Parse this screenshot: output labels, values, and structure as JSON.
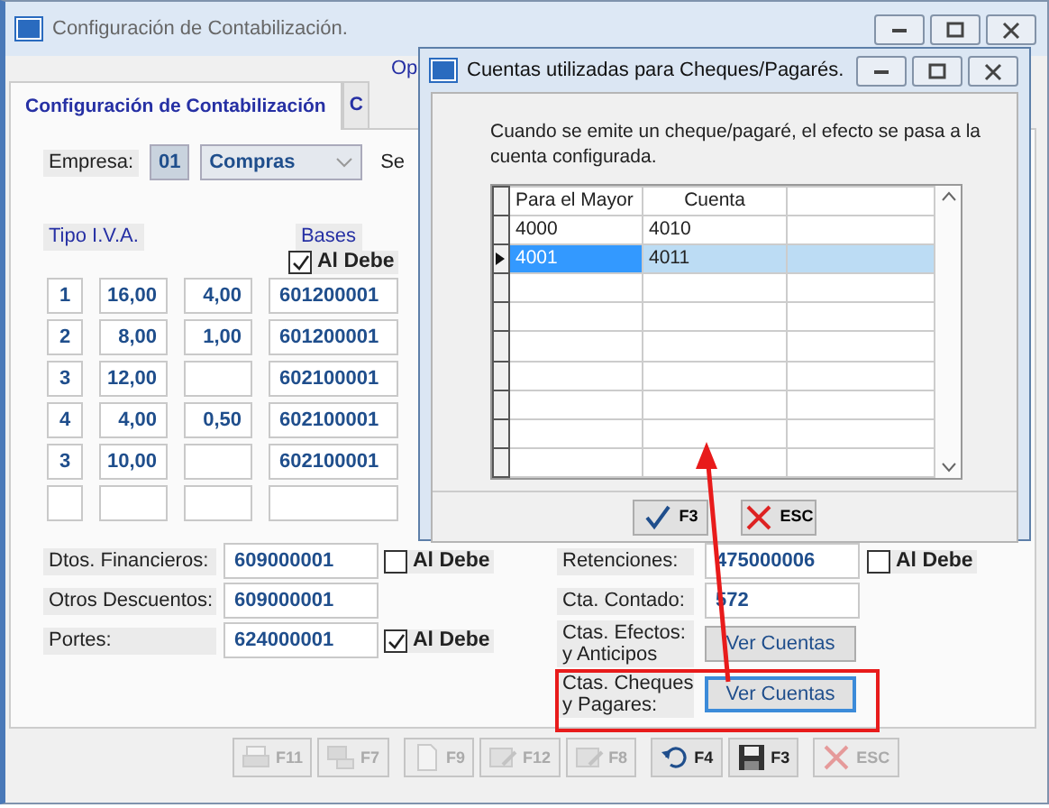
{
  "main_window": {
    "title": "Configuración de Contabilización.",
    "top_link": "Op",
    "tabs": [
      {
        "label": "Configuración de Contabilización",
        "selected": true
      },
      {
        "label": "C",
        "selected": false
      }
    ],
    "empresa": {
      "label": "Empresa:",
      "code": "01",
      "value": "Compras",
      "next_label": "Se"
    },
    "iva": {
      "tipo_header": "Tipo I.V.A.",
      "bases_header": "Bases",
      "al_debe": {
        "label": "Al Debe",
        "checked": true
      },
      "rows": [
        {
          "tipo": "1",
          "column_2": "16,00",
          "column_3": "4,00",
          "base": "601200001"
        },
        {
          "tipo": "2",
          "column_2": "8,00",
          "column_3": "1,00",
          "base": "601200001"
        },
        {
          "tipo": "3",
          "column_2": "12,00",
          "base": "602100001"
        },
        {
          "tipo": "4",
          "column_2": "4,00",
          "column_3": "0,50",
          "base": "602100001"
        },
        {
          "tipo": "3",
          "column_2": "10,00",
          "base": "602100001"
        },
        {}
      ]
    },
    "left_fields": [
      {
        "label": "Dtos. Financieros:",
        "value": "609000001",
        "al_debe": {
          "label": "Al Debe",
          "checked": false
        }
      },
      {
        "label": "Otros Descuentos:",
        "value": "609000001"
      },
      {
        "label": "Portes:",
        "value": "624000001",
        "al_debe": {
          "label": "Al Debe",
          "checked": true
        }
      }
    ],
    "right_fields": [
      {
        "kind": "field",
        "label": "Retenciones:",
        "value": "475000006",
        "al_debe": {
          "label": "Al Debe",
          "checked": false
        }
      },
      {
        "kind": "field",
        "label": "Cta. Contado:",
        "value": "572"
      },
      {
        "kind": "button",
        "label": "Ctas. Efectos:\ny Anticipos",
        "button": "Ver Cuentas",
        "focused": false
      },
      {
        "kind": "button",
        "label": "Ctas. Cheques\ny Pagares:",
        "button": "Ver Cuentas",
        "focused": true
      }
    ],
    "toolbar": [
      {
        "label": "F11",
        "disabled": true
      },
      {
        "label": "F7",
        "disabled": true
      },
      {
        "label": "F9",
        "disabled": true
      },
      {
        "label": "F12",
        "disabled": true
      },
      {
        "label": "F8",
        "disabled": true
      },
      {
        "label": "F4",
        "disabled": false
      },
      {
        "label": "F3",
        "disabled": false
      },
      {
        "label": "ESC",
        "disabled": true
      }
    ]
  },
  "dialog": {
    "title": "Cuentas utilizadas para Cheques/Pagarés.",
    "message": "Cuando se emite un cheque/pagaré, el efecto se pasa a la cuenta configurada.",
    "columns": [
      "Para el Mayor",
      "Cuenta"
    ],
    "rows": [
      {
        "cells": [
          "4000",
          "4010"
        ],
        "selected": false
      },
      {
        "cells": [
          "4001",
          "4011"
        ],
        "selected": true
      }
    ],
    "buttons": [
      {
        "label": "F3"
      },
      {
        "label": "ESC"
      }
    ]
  }
}
